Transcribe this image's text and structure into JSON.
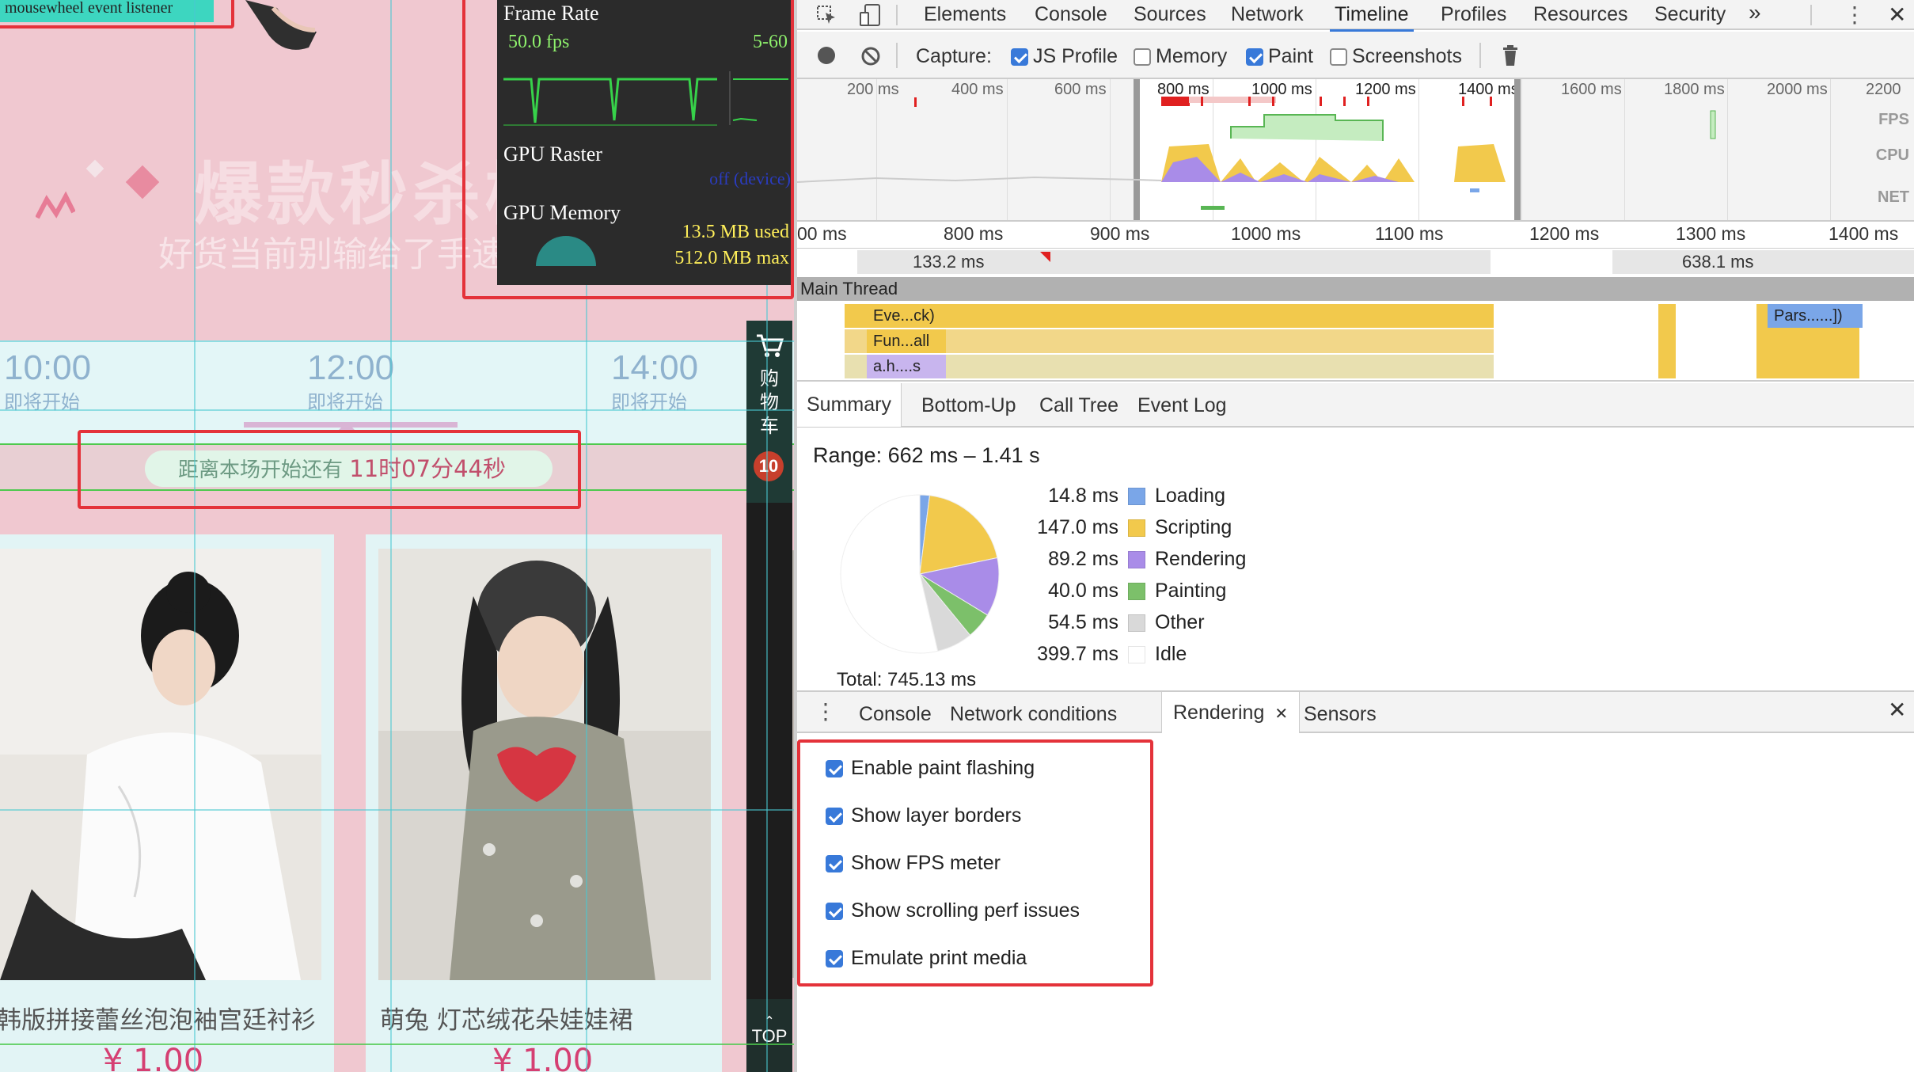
{
  "page": {
    "listener_label": "mousewheel event listener",
    "banner_title": "爆款秒杀榜",
    "banner_sub": "好货当前别输给了手速",
    "times": [
      {
        "time": "10:00",
        "status": "即将开始"
      },
      {
        "time": "12:00",
        "status": "即将开始"
      },
      {
        "time": "14:00",
        "status": "即将开始"
      }
    ],
    "countdown_prefix": "距离本场开始还有",
    "countdown_value": "11时07分44秒",
    "cart_label": "购物车",
    "cart_count": "10",
    "top_label": "TOP",
    "products": [
      {
        "name": "韩版拼接蕾丝泡泡袖宫廷衬衫",
        "price": "¥ 1.00"
      },
      {
        "name": "萌兔 灯芯绒花朵娃娃裙",
        "price": "¥ 1.00"
      }
    ]
  },
  "fps_meter": {
    "frame_rate_label": "Frame Rate",
    "fps": "50.0 fps",
    "range": "5-60",
    "gpu_raster_label": "GPU Raster",
    "gpu_raster_status": "off (device)",
    "gpu_memory_label": "GPU Memory",
    "gpu_used": "13.5 MB used",
    "gpu_max": "512.0 MB max"
  },
  "devtools": {
    "tabs": [
      "Elements",
      "Console",
      "Sources",
      "Network",
      "Timeline",
      "Profiles",
      "Resources",
      "Security"
    ],
    "active_tab": "Timeline",
    "more_icon": "»",
    "capture_label": "Capture:",
    "capture_options": [
      {
        "label": "JS Profile",
        "checked": true
      },
      {
        "label": "Memory",
        "checked": false
      },
      {
        "label": "Paint",
        "checked": true
      },
      {
        "label": "Screenshots",
        "checked": false
      }
    ],
    "overview_marks": [
      "200 ms",
      "400 ms",
      "600 ms",
      "800 ms",
      "1000 ms",
      "1200 ms",
      "1400 ms",
      "1600 ms",
      "1800 ms",
      "2000 ms",
      "2200"
    ],
    "overview_lanes": [
      "FPS",
      "CPU",
      "NET"
    ],
    "ruler_marks": [
      "00 ms",
      "800 ms",
      "900 ms",
      "1000 ms",
      "1100 ms",
      "1200 ms",
      "1300 ms",
      "1400 ms"
    ],
    "frame_durations": [
      "133.2 ms",
      "638.1 ms"
    ],
    "main_thread_label": "Main Thread",
    "flame_labels": [
      "Eve...ck)",
      "Fun...all",
      "a.h....s",
      "Pars......])"
    ],
    "summary_tabs": [
      "Summary",
      "Bottom-Up",
      "Call Tree",
      "Event Log"
    ],
    "range_text": "Range: 662 ms – 1.41 s",
    "legend": [
      {
        "value": "14.8 ms",
        "name": "Loading",
        "color": "#7aa6e8"
      },
      {
        "value": "147.0 ms",
        "name": "Scripting",
        "color": "#f2c94c"
      },
      {
        "value": "89.2 ms",
        "name": "Rendering",
        "color": "#a98ce8"
      },
      {
        "value": "40.0 ms",
        "name": "Painting",
        "color": "#7cc06a"
      },
      {
        "value": "54.5 ms",
        "name": "Other",
        "color": "#d9d9d9"
      },
      {
        "value": "399.7 ms",
        "name": "Idle",
        "color": "#ffffff"
      }
    ],
    "total": "Total: 745.13 ms",
    "drawer_tabs": [
      "Console",
      "Network conditions",
      "Rendering",
      "Sensors"
    ],
    "active_drawer_tab": "Rendering",
    "rendering_options": [
      {
        "label": "Enable paint flashing",
        "checked": true
      },
      {
        "label": "Show layer borders",
        "checked": true
      },
      {
        "label": "Show FPS meter",
        "checked": true
      },
      {
        "label": "Show scrolling perf issues",
        "checked": true
      },
      {
        "label": "Emulate print media",
        "checked": true
      }
    ]
  }
}
